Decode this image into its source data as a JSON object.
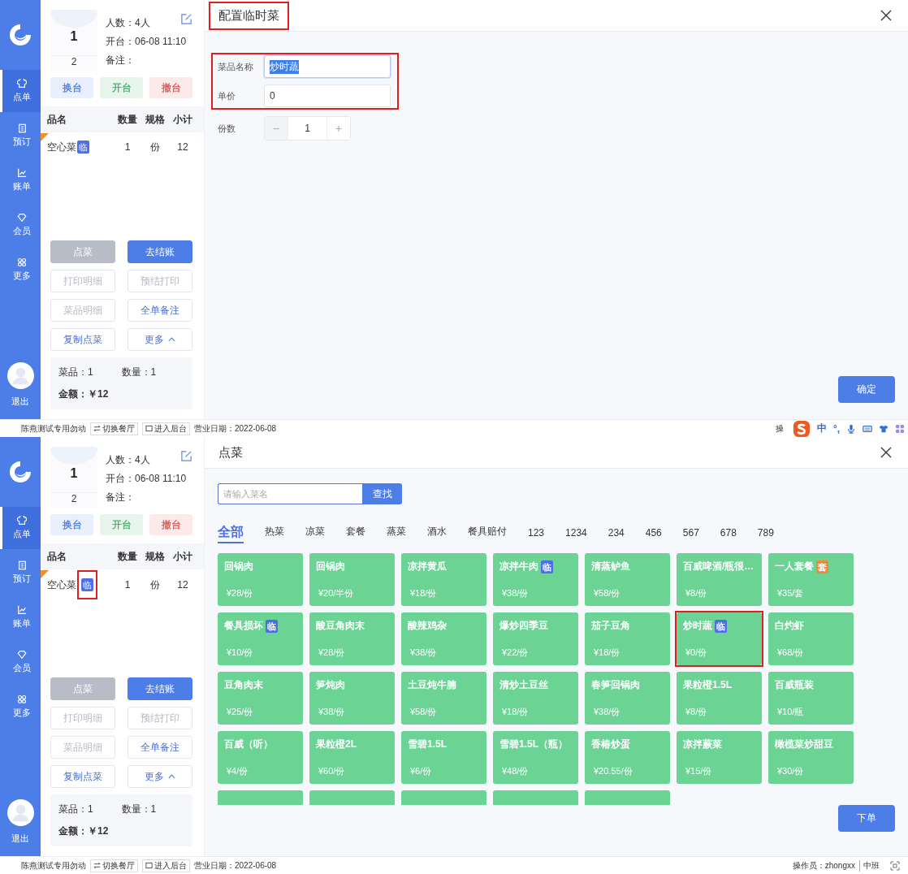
{
  "screens": [
    {
      "sidebar": {
        "items": [
          {
            "label": "点单",
            "selected": true
          },
          {
            "label": "预订",
            "selected": false
          },
          {
            "label": "账单",
            "selected": false
          },
          {
            "label": "会员",
            "selected": false
          },
          {
            "label": "更多",
            "selected": false
          }
        ],
        "logout": "退出"
      },
      "table": {
        "number": "1",
        "seats": "2",
        "guests": "人数：4人",
        "opened": "开台：06-08 11:10",
        "note": "备注："
      },
      "table_actions": [
        {
          "label": "换台",
          "color": "#4a7be6"
        },
        {
          "label": "开台",
          "color": "#3fae5f"
        },
        {
          "label": "撤台",
          "color": "#e0514d"
        }
      ],
      "order": {
        "columns": [
          "品名",
          "数量",
          "规格",
          "小计"
        ],
        "rows": [
          {
            "name": "空心菜",
            "tag": "临",
            "tag_highlighted": false,
            "quantity": "1",
            "unit": "份",
            "subtotal": "12"
          }
        ]
      },
      "buttons": [
        {
          "label": "点菜",
          "kind": "grey",
          "disabled": false
        },
        {
          "label": "去结账",
          "kind": "primary",
          "disabled": false
        },
        {
          "label": "打印明细",
          "kind": "outline",
          "disabled": true
        },
        {
          "label": "预结打印",
          "kind": "outline",
          "disabled": true
        },
        {
          "label": "菜品明细",
          "kind": "outline",
          "disabled": true
        },
        {
          "label": "全单备注",
          "kind": "outline",
          "disabled": false
        },
        {
          "label": "复制点菜",
          "kind": "outline",
          "disabled": false
        },
        {
          "label": "更多",
          "kind": "dropdown",
          "disabled": false
        }
      ],
      "summary": {
        "dishes": "菜品：1",
        "quantity": "数量：1",
        "amount": "金额：￥12"
      },
      "dialog": {
        "kind": "temp_dish",
        "title": "配置临时菜",
        "title_highlighted": true,
        "fields": [
          {
            "label": "菜品名称",
            "value": "炒时蔬",
            "focused": true
          },
          {
            "label": "单价",
            "value": "0",
            "focused": false
          }
        ],
        "fields_highlighted": true,
        "portions": {
          "label": "份数",
          "minus": "−",
          "value": "1",
          "plus": "+"
        },
        "confirm": "确定"
      },
      "status_bar": {
        "store": "陈燕测试专用勿动",
        "buttons": [
          "切换餐厅",
          "进入后台"
        ],
        "date": "营业日期：2022-06-08",
        "operator": "操"
      },
      "ime_toolbar": {
        "texts": [
          "中",
          "°,"
        ]
      }
    },
    {
      "sidebar": {
        "items": [
          {
            "label": "点单",
            "selected": true
          },
          {
            "label": "预订",
            "selected": false
          },
          {
            "label": "账单",
            "selected": false
          },
          {
            "label": "会员",
            "selected": false
          },
          {
            "label": "更多",
            "selected": false
          }
        ],
        "logout": "退出"
      },
      "table": {
        "number": "1",
        "seats": "2",
        "guests": "人数：4人",
        "opened": "开台：06-08 11:10",
        "note": "备注："
      },
      "table_actions": [
        {
          "label": "换台",
          "color": "#4a7be6"
        },
        {
          "label": "开台",
          "color": "#3fae5f"
        },
        {
          "label": "撤台",
          "color": "#e0514d"
        }
      ],
      "order": {
        "columns": [
          "品名",
          "数量",
          "规格",
          "小计"
        ],
        "rows": [
          {
            "name": "空心菜",
            "tag": "临",
            "tag_highlighted": true,
            "quantity": "1",
            "unit": "份",
            "subtotal": "12"
          }
        ]
      },
      "buttons": [
        {
          "label": "点菜",
          "kind": "grey",
          "disabled": false
        },
        {
          "label": "去结账",
          "kind": "primary",
          "disabled": false
        },
        {
          "label": "打印明细",
          "kind": "outline",
          "disabled": true
        },
        {
          "label": "预结打印",
          "kind": "outline",
          "disabled": true
        },
        {
          "label": "菜品明细",
          "kind": "outline",
          "disabled": true
        },
        {
          "label": "全单备注",
          "kind": "outline",
          "disabled": false
        },
        {
          "label": "复制点菜",
          "kind": "outline",
          "disabled": false
        },
        {
          "label": "更多",
          "kind": "dropdown",
          "disabled": false
        }
      ],
      "summary": {
        "dishes": "菜品：1",
        "quantity": "数量：1",
        "amount": "金额：￥12"
      },
      "dialog": {
        "kind": "menu",
        "title": "点菜",
        "title_highlighted": false,
        "search": {
          "placeholder": "请输入菜名",
          "button": "查找"
        },
        "categories": [
          {
            "label": "全部",
            "selected": true
          },
          {
            "label": "热菜",
            "selected": false
          },
          {
            "label": "凉菜",
            "selected": false
          },
          {
            "label": "套餐",
            "selected": false
          },
          {
            "label": "蒸菜",
            "selected": false
          },
          {
            "label": "酒水",
            "selected": false
          },
          {
            "label": "餐具赔付",
            "selected": false
          },
          {
            "label": "123",
            "selected": false
          },
          {
            "label": "1234",
            "selected": false
          },
          {
            "label": "234",
            "selected": false
          },
          {
            "label": "456",
            "selected": false
          },
          {
            "label": "567",
            "selected": false
          },
          {
            "label": "678",
            "selected": false
          },
          {
            "label": "789",
            "selected": false
          }
        ],
        "dishes": [
          {
            "name": "回锅肉",
            "price": "¥28/份",
            "highlighted": false
          },
          {
            "name": "回锅肉",
            "price": "¥20/半份",
            "highlighted": false
          },
          {
            "name": "凉拌黄瓜",
            "price": "¥18/份",
            "highlighted": false
          },
          {
            "name": "凉拌牛肉",
            "tag": {
              "text": "临",
              "kind": "temp"
            },
            "price": "¥38/份",
            "highlighted": false
          },
          {
            "name": "清蒸鲈鱼",
            "price": "¥58/份",
            "highlighted": false
          },
          {
            "name": "百威啤酒/瓶很…",
            "price": "¥8/份",
            "highlighted": false
          },
          {
            "name": "一人套餐",
            "tag": {
              "text": "套",
              "kind": "set"
            },
            "price": "¥35/套",
            "highlighted": false
          },
          {
            "name": "餐具损坏",
            "tag": {
              "text": "临",
              "kind": "temp"
            },
            "price": "¥10/份",
            "highlighted": false
          },
          {
            "name": "酸豆角肉末",
            "price": "¥28/份",
            "highlighted": false
          },
          {
            "name": "酸辣鸡杂",
            "price": "¥38/份",
            "highlighted": false
          },
          {
            "name": "爆炒四季豆",
            "price": "¥22/份",
            "highlighted": false
          },
          {
            "name": "茄子豆角",
            "price": "¥18/份",
            "highlighted": false
          },
          {
            "name": "炒时蔬",
            "tag": {
              "text": "临",
              "kind": "temp"
            },
            "price": "¥0/份",
            "highlighted": true
          },
          {
            "name": "白灼虾",
            "price": "¥68/份",
            "highlighted": false
          },
          {
            "name": "豆角肉末",
            "price": "¥25/份",
            "highlighted": false
          },
          {
            "name": "笋炖肉",
            "price": "¥38/份",
            "highlighted": false
          },
          {
            "name": "土豆炖牛腩",
            "price": "¥58/份",
            "highlighted": false
          },
          {
            "name": "清炒土豆丝",
            "price": "¥18/份",
            "highlighted": false
          },
          {
            "name": "春笋回锅肉",
            "price": "¥38/份",
            "highlighted": false
          },
          {
            "name": "果粒橙1.5L",
            "price": "¥8/份",
            "highlighted": false
          },
          {
            "name": "百威瓶装",
            "price": "¥10/瓶",
            "highlighted": false
          },
          {
            "name": "百威（听）",
            "price": "¥4/份",
            "highlighted": false
          },
          {
            "name": "果粒橙2L",
            "price": "¥60/份",
            "highlighted": false
          },
          {
            "name": "雪碧1.5L",
            "price": "¥6/份",
            "highlighted": false
          },
          {
            "name": "雪碧1.5L（瓶）",
            "price": "¥48/份",
            "highlighted": false
          },
          {
            "name": "香椿炒蛋",
            "price": "¥20.55/份",
            "highlighted": false
          },
          {
            "name": "凉拌蕨菜",
            "price": "¥15/份",
            "highlighted": false
          },
          {
            "name": "橄榄菜炒甜豆",
            "price": "¥30/份",
            "highlighted": false
          },
          {
            "highlighted": false
          },
          {
            "highlighted": false
          },
          {
            "highlighted": false
          },
          {
            "highlighted": false
          },
          {
            "highlighted": false
          }
        ],
        "submit": "下单"
      },
      "status_bar": {
        "store": "陈燕测试专用勿动",
        "buttons": [
          "切换餐厅",
          "进入后台"
        ],
        "date": "营业日期：2022-06-08",
        "operator": "操作员：zhongxx",
        "shift": "中班"
      }
    }
  ]
}
